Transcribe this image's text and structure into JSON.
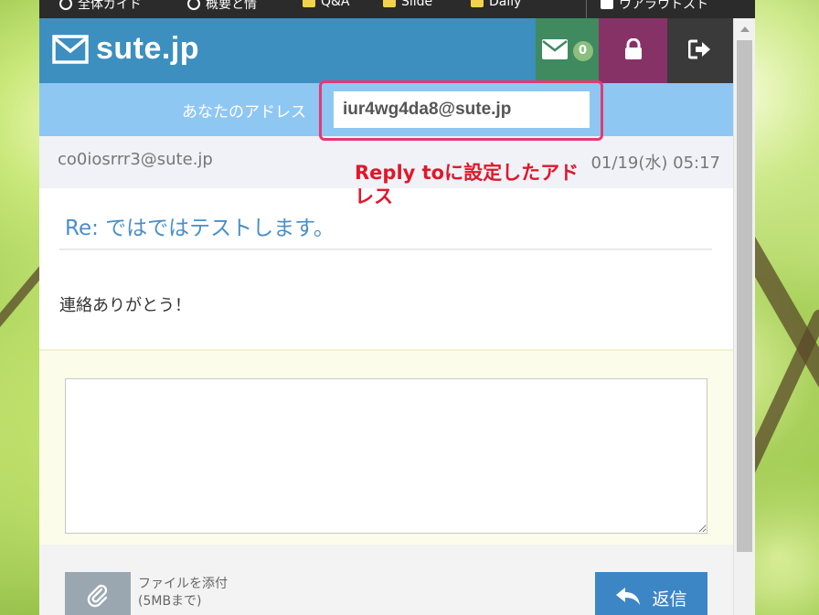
{
  "topbar": {
    "items": [
      "全体ガイド",
      "概要と情",
      "Q&A",
      "Slide",
      "Daily"
    ],
    "right": "ウアラウトスト"
  },
  "header": {
    "logo": "sute.jp",
    "mail_count": "0",
    "colors": {
      "header": "#3d8fbf",
      "mail": "#3f8a5f",
      "lock": "#873267",
      "logout": "#3a3a3a"
    }
  },
  "address": {
    "label": "あなたのアドレス",
    "value": "iur4wg4da8@sute.jp"
  },
  "mail": {
    "sender": "co0iosrrr3@sute.jp",
    "date": "01/19(水) 05:17",
    "subject": "Re: ではではテストします。",
    "body": "連絡ありがとう！"
  },
  "annotation": {
    "text": "Reply toに設定したアドレス",
    "color": "#e0172b"
  },
  "reply": {
    "textarea_value": "",
    "attach_label_line1": "ファイルを添付",
    "attach_label_line2": "(5MBまで)",
    "send_label": "返信"
  }
}
